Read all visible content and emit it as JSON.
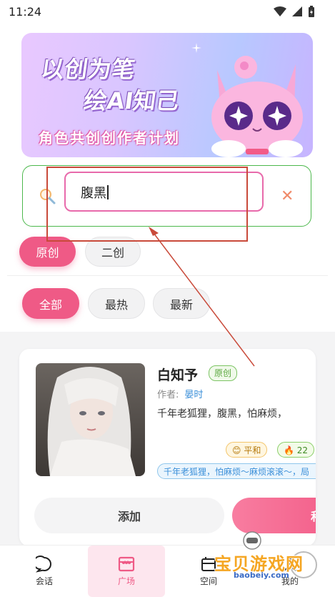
{
  "status_bar": {
    "time": "11:24"
  },
  "banner": {
    "line1": "以创为笔",
    "line2": "绘AI知己",
    "line3": "角色共创创作者计划"
  },
  "search": {
    "value": "腹黑",
    "clear_symbol": "✕"
  },
  "source_filters": [
    {
      "label": "原创",
      "active": true
    },
    {
      "label": "二创",
      "active": false
    }
  ],
  "sort_filters": [
    {
      "label": "全部",
      "active": true
    },
    {
      "label": "最热",
      "active": false
    },
    {
      "label": "最新",
      "active": false
    }
  ],
  "character_card": {
    "name": "白知予",
    "origin_tag": "原创",
    "author_label": "作者:",
    "author_name": "晏时",
    "description": "千年老狐狸，腹黑，怕麻烦，",
    "mood_badge": "平和",
    "heat_count": "22",
    "tag_line": "千年老狐狸，怕麻烦～麻烦滚滚～，局",
    "add_label": "添加",
    "chat_label": "和"
  },
  "bottom_nav": [
    {
      "label": "会话",
      "icon": "chat-bubble-icon",
      "active": false
    },
    {
      "label": "广场",
      "icon": "storefront-icon",
      "active": true
    },
    {
      "label": "空间",
      "icon": "space-icon",
      "active": false
    },
    {
      "label": "我的",
      "icon": "profile-icon",
      "active": false
    }
  ],
  "watermark": {
    "title": "宝贝游戏网",
    "url": "baobeiy.com"
  },
  "colors": {
    "accent": "#ef5a86",
    "annotation": "#c94a3a",
    "search_border": "#e86aab"
  }
}
